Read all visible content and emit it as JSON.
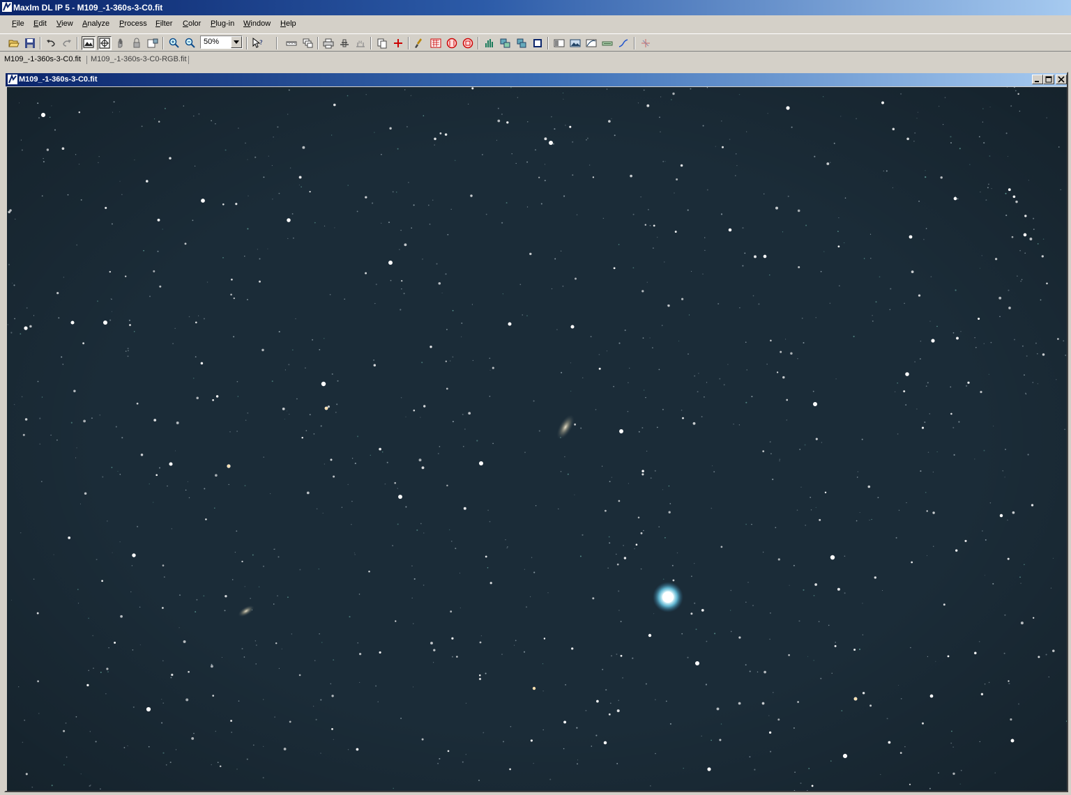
{
  "app": {
    "title": "MaxIm DL IP 5 - M109_-1-360s-3-C0.fit"
  },
  "menu": [
    {
      "label": "File",
      "accel": "F",
      "rest": "ile"
    },
    {
      "label": "Edit",
      "accel": "E",
      "rest": "dit"
    },
    {
      "label": "View",
      "accel": "V",
      "rest": "iew"
    },
    {
      "label": "Analyze",
      "accel": "A",
      "rest": "nalyze"
    },
    {
      "label": "Process",
      "accel": "P",
      "rest": "rocess"
    },
    {
      "label": "Filter",
      "accel": "F",
      "rest": "ilter"
    },
    {
      "label": "Color",
      "accel": "C",
      "rest": "olor"
    },
    {
      "label": "Plug-in",
      "accel": "P",
      "rest": "lug-in"
    },
    {
      "label": "Window",
      "accel": "W",
      "rest": "indow"
    },
    {
      "label": "Help",
      "accel": "H",
      "rest": "elp"
    }
  ],
  "toolbar": {
    "zoom_value": "50%",
    "icons": [
      "open-icon",
      "save-icon",
      "undo-icon",
      "redo-icon",
      "screen-stretch-icon",
      "crosshair-icon",
      "hand-icon",
      "lock-icon",
      "settings-icon",
      "zoom-in-icon",
      "zoom-out-icon",
      "help-pointer-icon",
      "ruler-icon",
      "layers-icon",
      "print-icon",
      "tools-icon",
      "measure-icon",
      "copy-icon",
      "crosshair-plus-icon",
      "brush-icon",
      "filter-icon",
      "color-icon",
      "remove-icon",
      "histogram-icon",
      "align-icon",
      "stack-icon",
      "frame-icon",
      "screen-icon",
      "image-icon",
      "curve-icon",
      "info-icon",
      "curve-line-icon",
      "add-icon"
    ]
  },
  "doc_tabs": [
    {
      "label": "M109_-1-360s-3-C0.fit",
      "active": true
    },
    {
      "label": "M109_-1-360s-3-C0-RGB.fit",
      "active": false
    }
  ],
  "image_window": {
    "title": "M109_-1-360s-3-C0.fit",
    "background": "#1b2c38",
    "subject": "star field with galaxy M109"
  },
  "colors": {
    "titlebar_start": "#0a246a",
    "titlebar_end": "#a6caf0",
    "chrome": "#d4d0c8",
    "sky": "#1b2c38"
  }
}
